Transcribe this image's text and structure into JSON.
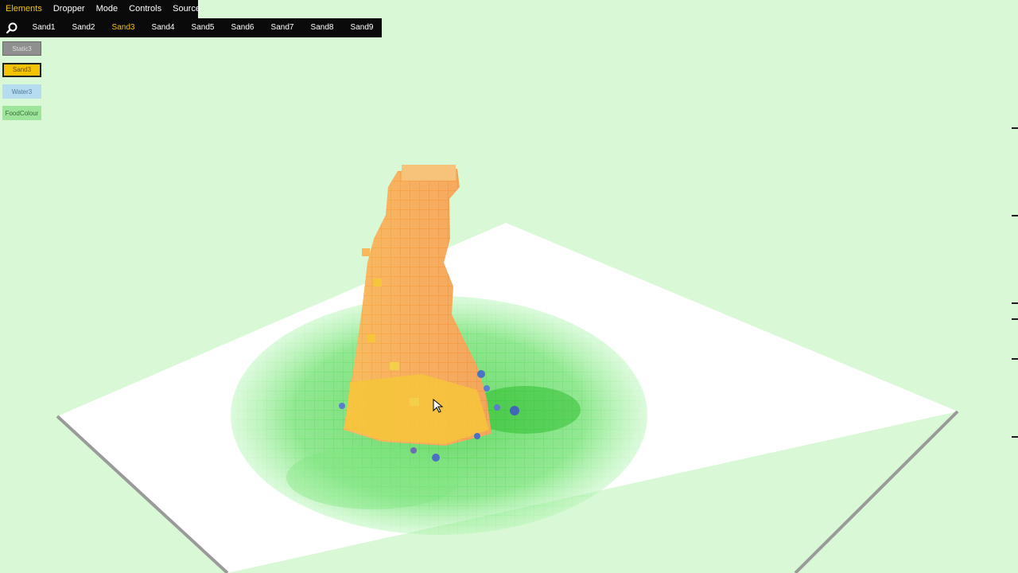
{
  "menu": [
    {
      "label": "Elements",
      "active": true
    },
    {
      "label": "Dropper",
      "active": false
    },
    {
      "label": "Mode",
      "active": false
    },
    {
      "label": "Controls",
      "active": false
    },
    {
      "label": "Source",
      "active": false
    }
  ],
  "toolbar": {
    "search_icon": "search-icon",
    "tabs": [
      {
        "label": "Sand1",
        "active": false
      },
      {
        "label": "Sand2",
        "active": false
      },
      {
        "label": "Sand3",
        "active": true
      },
      {
        "label": "Sand4",
        "active": false
      },
      {
        "label": "Sand5",
        "active": false
      },
      {
        "label": "Sand6",
        "active": false
      },
      {
        "label": "Sand7",
        "active": false
      },
      {
        "label": "Sand8",
        "active": false
      },
      {
        "label": "Sand9",
        "active": false
      }
    ]
  },
  "palette": [
    {
      "label": "Static3",
      "selected": false
    },
    {
      "label": "Sand3",
      "selected": true
    },
    {
      "label": "Water3",
      "selected": false
    },
    {
      "label": "FoodColour",
      "selected": false
    }
  ],
  "colors": {
    "background": "#d9f9d6",
    "floor": "#ffffff",
    "sand": "#f4a14a",
    "sand_highlight": "#f6c53a",
    "food_colour": "#5fe05a",
    "water": "#4a6fc4",
    "accent": "#f4c400",
    "bar": "#0a0a0a"
  }
}
